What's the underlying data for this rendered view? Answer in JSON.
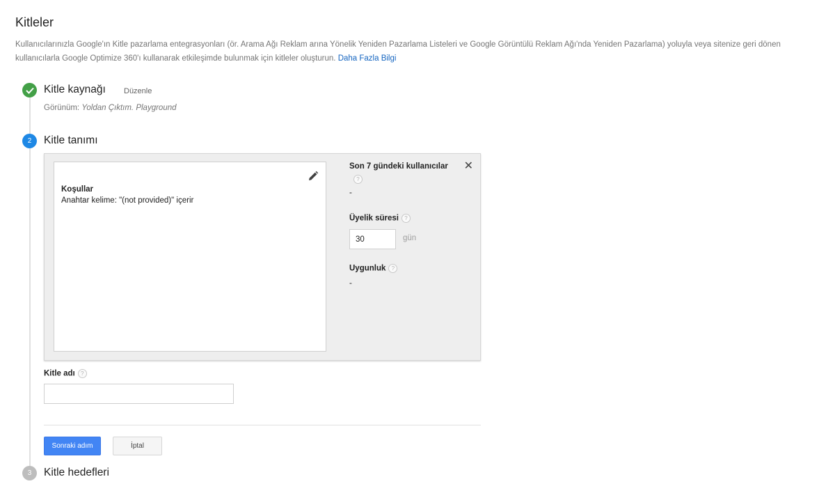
{
  "page": {
    "title": "Kitleler",
    "intro_text": "Kullanıcılarınızla Google'ın Kitle pazarlama entegrasyonları (ör. Arama Ağı Reklam arına Yönelik Yeniden Pazarlama Listeleri ve Google Görüntülü Reklam Ağı'nda Yeniden Pazarlama) yoluyla veya sitenize geri dönen kullanıcılarla Google Optimize 360'ı kullanarak etkileşimde bulunmak için kitleler oluşturun.",
    "learn_more_link": "Daha Fazla Bilgi"
  },
  "steps": {
    "source": {
      "title": "Kitle kaynağı",
      "edit_label": "Düzenle",
      "view_label": "Görünüm:",
      "view_value": "Yoldan Çıktım. Playground",
      "status_icon": "check-icon"
    },
    "definition": {
      "number": "2",
      "title": "Kitle tanımı",
      "conditions_title": "Koşullar",
      "conditions_text": "Anahtar kelime: \"(not provided)\" içerir",
      "users_7_days_label": "Son 7 gündeki kullanıcılar",
      "users_7_days_value": "-",
      "membership_label": "Üyelik süresi",
      "membership_value": "30",
      "membership_unit": "gün",
      "eligibility_label": "Uygunluk",
      "eligibility_value": "-",
      "help_glyph": "?",
      "close_glyph": "✕"
    },
    "destinations": {
      "number": "3",
      "title": "Kitle hedefleri"
    }
  },
  "form": {
    "name_label": "Kitle adı",
    "name_value": "",
    "next_button": "Sonraki adım",
    "cancel_button": "İptal"
  },
  "colors": {
    "primary": "#4285f4",
    "done": "#43a047",
    "active": "#1e88e5",
    "pending": "#bdbdbd",
    "link": "#1565c0"
  }
}
